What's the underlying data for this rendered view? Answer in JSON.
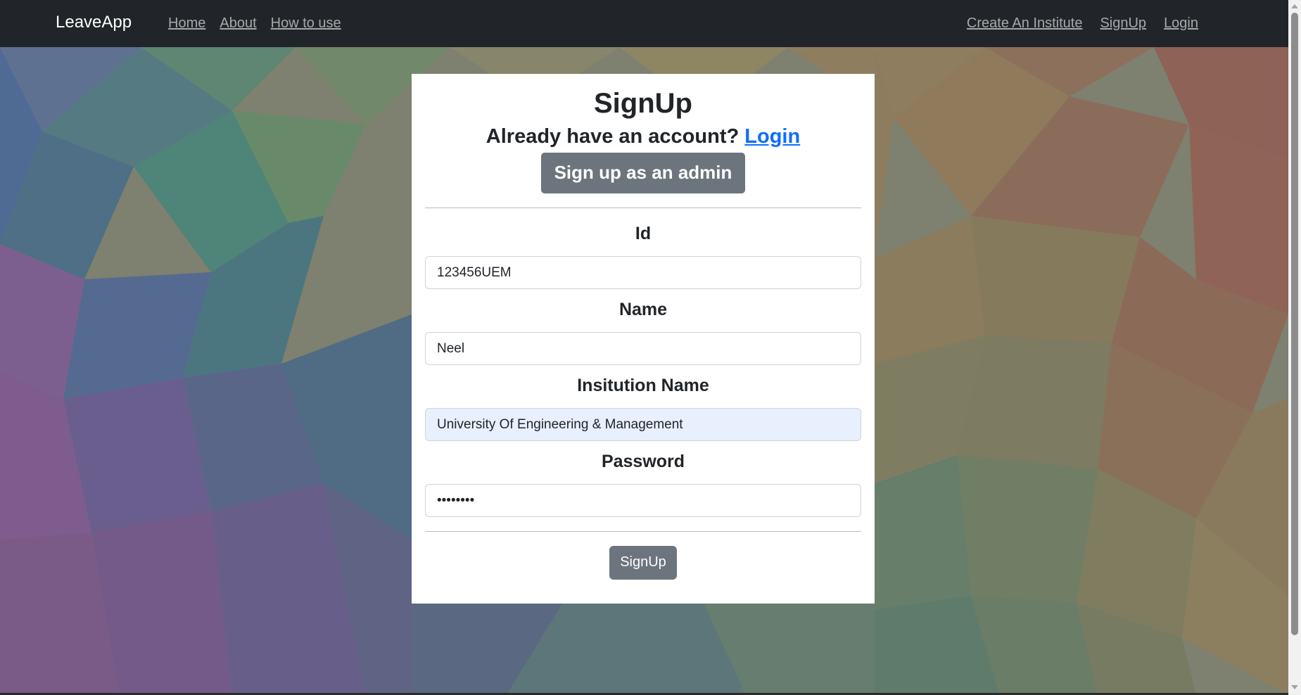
{
  "navbar": {
    "brand": "LeaveApp",
    "left_links": [
      "Home",
      "About",
      "How to use"
    ],
    "right_links": [
      "Create An Institute",
      "SignUp",
      "Login"
    ]
  },
  "form": {
    "title": "SignUp",
    "subtitle_prefix": "Already have an account?",
    "subtitle_link": "Login",
    "admin_button": "Sign up as an admin",
    "fields": [
      {
        "label": "Id",
        "value": "123456UEM"
      },
      {
        "label": "Name",
        "value": "Neel"
      },
      {
        "label": "Insitution Name",
        "value": "University Of Engineering & Management"
      },
      {
        "label": "Password",
        "value": "••••••••"
      }
    ],
    "submit_button": "SignUp"
  },
  "colors": {
    "navbar_bg": "#212529",
    "nav_link": "rgba(255,255,255,0.6)",
    "button_bg": "#6c757d",
    "link": "#0d6efd",
    "autofill_bg": "#e8f0fe"
  }
}
